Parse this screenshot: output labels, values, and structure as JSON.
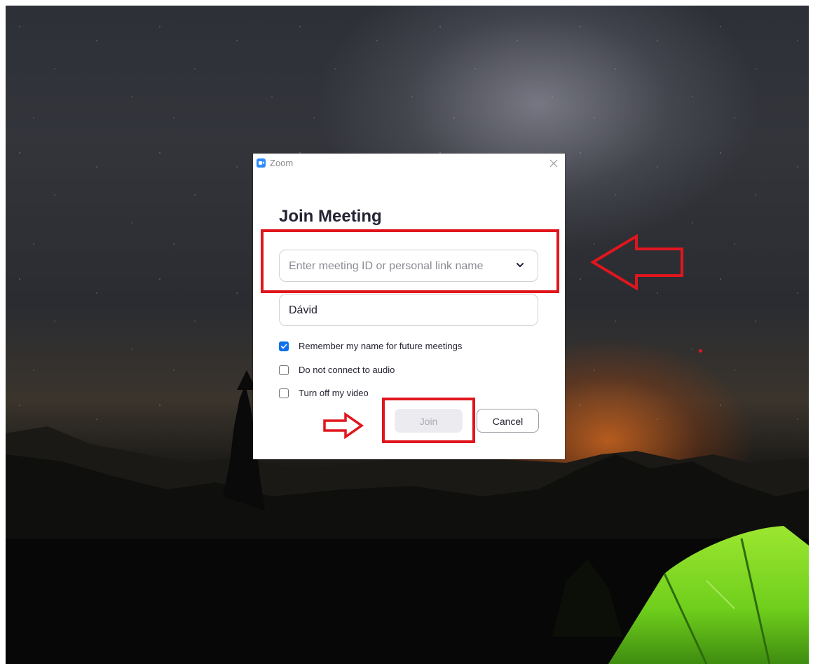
{
  "window": {
    "title": "Zoom"
  },
  "dialog": {
    "heading": "Join Meeting",
    "meeting_input": {
      "placeholder": "Enter meeting ID or personal link name",
      "value": ""
    },
    "name_input": {
      "value": "Dávid"
    },
    "options": [
      {
        "label": "Remember my name for future meetings",
        "checked": true
      },
      {
        "label": "Do not connect to audio",
        "checked": false
      },
      {
        "label": "Turn off my video",
        "checked": false
      }
    ],
    "buttons": {
      "join_label": "Join",
      "join_enabled": false,
      "cancel_label": "Cancel"
    }
  },
  "colors": {
    "accent": "#0e71eb",
    "annotation": "#e0161e",
    "tent": "#7ddb1f"
  },
  "icons": {
    "app": "zoom-camera-icon",
    "close": "close-icon",
    "dropdown": "chevron-down-icon",
    "check": "checkmark-icon"
  }
}
